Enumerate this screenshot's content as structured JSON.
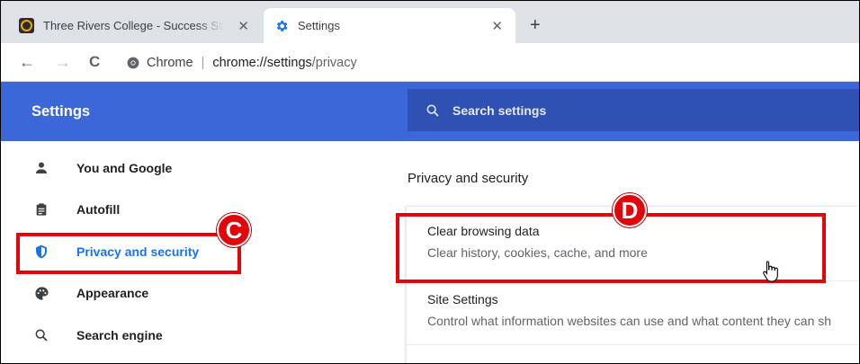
{
  "tabs": [
    {
      "title": "Three Rivers College - Success Strategies",
      "close": "✕",
      "favicon": "three-rivers-icon"
    },
    {
      "title": "Settings",
      "close": "✕",
      "favicon": "gear-icon"
    }
  ],
  "new_tab": "+",
  "toolbar": {
    "back": "←",
    "forward": "→",
    "reload": "C",
    "chrome_label": "Chrome",
    "separator": "|",
    "url_host": "chrome://settings",
    "url_path": "/privacy"
  },
  "header": {
    "title": "Settings",
    "search_placeholder": "Search settings"
  },
  "sidebar": {
    "items": [
      {
        "label": "You and Google",
        "icon": "person-icon"
      },
      {
        "label": "Autofill",
        "icon": "clipboard-icon"
      },
      {
        "label": "Privacy and security",
        "icon": "shield-icon",
        "active": true
      },
      {
        "label": "Appearance",
        "icon": "palette-icon"
      },
      {
        "label": "Search engine",
        "icon": "search-icon"
      }
    ]
  },
  "main": {
    "section_title": "Privacy and security",
    "rows": [
      {
        "title": "Clear browsing data",
        "subtitle": "Clear history, cookies, cache, and more"
      },
      {
        "title": "Site Settings",
        "subtitle": "Control what information websites can use and what content they can sh"
      }
    ]
  },
  "annotations": {
    "c_label": "C",
    "d_label": "D",
    "color": "#e3050c"
  },
  "colors": {
    "header_blue": "#3c67d8",
    "search_blue": "#2f51b3",
    "active_blue": "#1a73e8"
  }
}
